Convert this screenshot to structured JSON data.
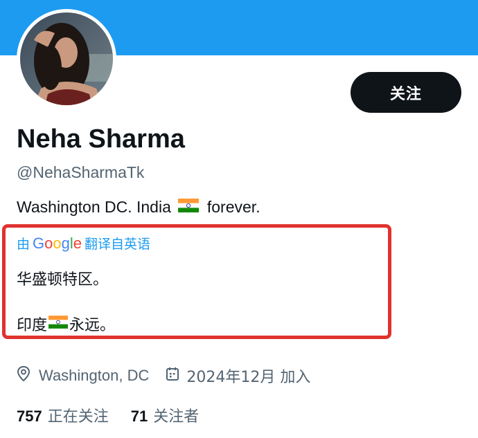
{
  "profile": {
    "name": "Neha Sharma",
    "handle": "@NehaSharmaTk",
    "follow_label": "关注",
    "bio_text_before": "Washington DC.  India",
    "bio_text_after": "forever.",
    "bio_flag": "india-flag-icon"
  },
  "translation": {
    "by_label": "由",
    "provider": "Google",
    "provider_letters": [
      "G",
      "o",
      "o",
      "g",
      "l",
      "e"
    ],
    "from_label": "翻译自英语",
    "line_1": "华盛顿特区。",
    "line_2_before": "印度",
    "line_2_after": "永远。"
  },
  "meta": {
    "location_icon": "location-pin-icon",
    "location": "Washington, DC",
    "calendar_icon": "calendar-icon",
    "joined": "2024年12月 加入"
  },
  "stats": {
    "following_count": "757",
    "following_label": "正在关注",
    "followers_count": "71",
    "followers_label": "关注者"
  },
  "colors": {
    "banner": "#1d9bf0",
    "follow_button_bg": "#0f1419",
    "highlight_border": "#e0322e",
    "secondary_text": "#536471"
  }
}
